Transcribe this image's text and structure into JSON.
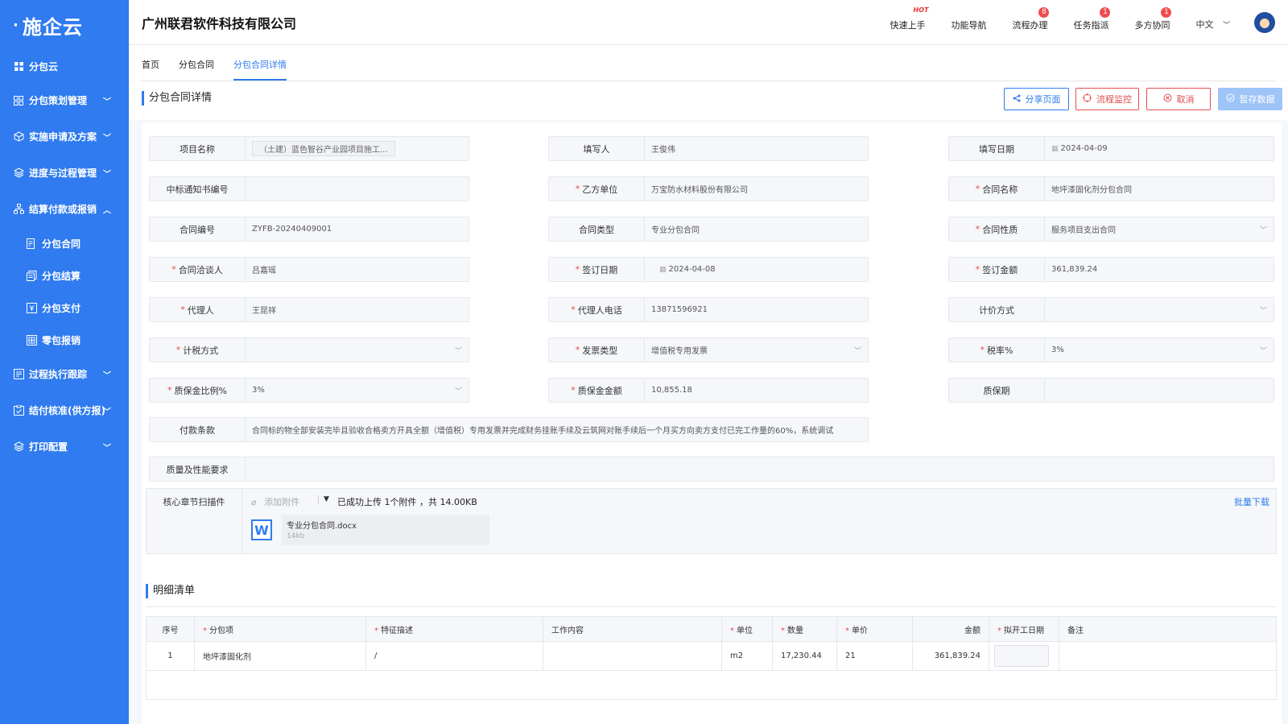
{
  "sidebar": {
    "logo": "施企云",
    "home": "分包云",
    "items": [
      {
        "label": "分包策划管理",
        "icon": "grid-icon"
      },
      {
        "label": "实施申请及方案",
        "icon": "cube-icon"
      },
      {
        "label": "进度与过程管理",
        "icon": "layers-icon"
      },
      {
        "label": "结算付款或报销",
        "icon": "org-icon"
      }
    ],
    "subitems": [
      {
        "label": "分包合同",
        "icon": "contract-icon"
      },
      {
        "label": "分包结算",
        "icon": "settle-icon"
      },
      {
        "label": "分包支付",
        "icon": "pay-icon"
      },
      {
        "label": "零包报销",
        "icon": "reimburse-icon"
      }
    ],
    "items2": [
      {
        "label": "过程执行跟踪",
        "icon": "track-icon"
      },
      {
        "label": "结付核准(供方报)",
        "icon": "approve-icon"
      },
      {
        "label": "打印配置",
        "icon": "print-icon"
      }
    ]
  },
  "header": {
    "company": "广州联君软件科技有限公司",
    "links": [
      {
        "label": "快速上手",
        "badge": "",
        "hot": "HOT"
      },
      {
        "label": "功能导航",
        "badge": "",
        "hot": ""
      },
      {
        "label": "流程办理",
        "badge": "8",
        "hot": ""
      },
      {
        "label": "任务指派",
        "badge": "1",
        "hot": ""
      },
      {
        "label": "多方协同",
        "badge": "1",
        "hot": ""
      }
    ],
    "lang": "中文"
  },
  "tabs": [
    "首页",
    "分包合同",
    "分包合同详情"
  ],
  "page": {
    "title": "分包合同详情",
    "buttons": {
      "share": "分享页面",
      "flow": "流程监控",
      "cancel": "取消",
      "save": "暂存数据"
    }
  },
  "form": {
    "project_name": {
      "label": "项目名称",
      "value": "（土建）蓝色智谷产业园项目施工..."
    },
    "writer": {
      "label": "填写人",
      "value": "王俊伟"
    },
    "write_date": {
      "label": "填写日期",
      "value": "2024-04-09"
    },
    "notice_no": {
      "label": "中标通知书编号",
      "value": ""
    },
    "party_b": {
      "label": "乙方单位",
      "value": "万宝防水材料股份有限公司"
    },
    "contract_name": {
      "label": "合同名称",
      "value": "地坪漆固化剂分包合同"
    },
    "contract_no": {
      "label": "合同编号",
      "value": "ZYFB-20240409001"
    },
    "contract_type": {
      "label": "合同类型",
      "value": "专业分包合同"
    },
    "contract_nature": {
      "label": "合同性质",
      "value": "服务项目支出合同"
    },
    "negotiator": {
      "label": "合同洽谈人",
      "value": "吕嘉瑶"
    },
    "sign_date": {
      "label": "签订日期",
      "value": "2024-04-08"
    },
    "sign_amount": {
      "label": "签订金额",
      "value": "361,839.24"
    },
    "agent": {
      "label": "代理人",
      "value": "王昆祥"
    },
    "agent_phone": {
      "label": "代理人电话",
      "value": "13871596921"
    },
    "price_method": {
      "label": "计价方式",
      "value": ""
    },
    "tax_method": {
      "label": "计税方式",
      "value": ""
    },
    "invoice_type": {
      "label": "发票类型",
      "value": "增值税专用发票"
    },
    "tax_rate": {
      "label": "税率%",
      "value": "3%"
    },
    "retention_ratio": {
      "label": "质保金比例%",
      "value": "3%"
    },
    "retention_amount": {
      "label": "质保金金额",
      "value": "10,855.18"
    },
    "warranty": {
      "label": "质保期",
      "value": ""
    },
    "payment_terms": {
      "label": "付款条款",
      "value": "合同标的物全部安装完毕且验收合格卖方开具全额（增值税）专用发票并完成财务挂账手续及云筑网对账手续后一个月买方向卖方支付已完工作量的60%，系统调试"
    },
    "quality": {
      "label": "质量及性能要求",
      "value": ""
    }
  },
  "attachment": {
    "label": "核心章节扫描件",
    "add": "添加附件",
    "info": "已成功上传 1个附件 ，共 14.00KB",
    "download": "批量下载",
    "file_name": "专业分包合同.docx",
    "file_size": "14kb"
  },
  "detail": {
    "title": "明细清单",
    "headers": [
      "序号",
      "分包项",
      "特征描述",
      "工作内容",
      "单位",
      "数量",
      "单价",
      "金额",
      "拟开工日期",
      "备注"
    ],
    "rows": [
      {
        "no": "1",
        "item": "地坪漆固化剂",
        "desc": "/",
        "content": "",
        "unit": "m2",
        "qty": "17,230.44",
        "price": "21",
        "amount": "361,839.24",
        "date": "",
        "remark": ""
      }
    ]
  },
  "colors": {
    "primary": "#2f7bef",
    "danger": "#e34d4d"
  }
}
